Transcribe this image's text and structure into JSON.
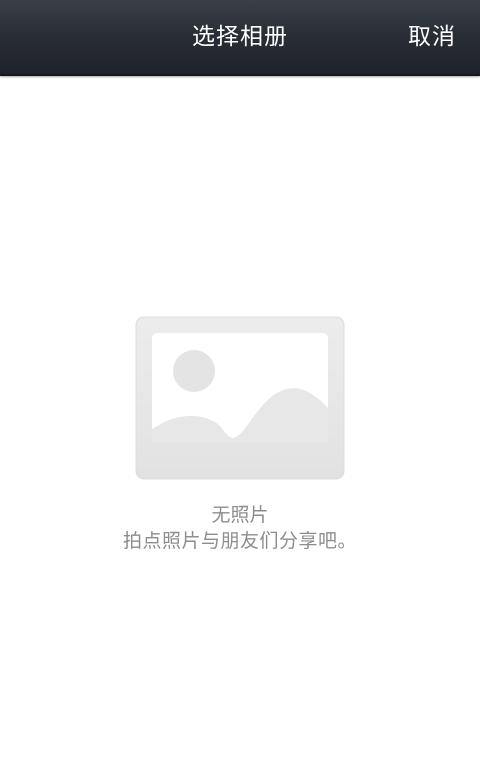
{
  "header": {
    "title": "选择相册",
    "cancel_label": "取消"
  },
  "empty_state": {
    "icon": "image-placeholder-icon",
    "title": "无照片",
    "subtitle": "拍点照片与朋友们分享吧。"
  },
  "colors": {
    "title_bar": "#2a2e36",
    "title_text": "#ffffff",
    "background": "#ffffff",
    "empty_text": "#8d8d8d",
    "placeholder_fill": "#e8e8e8"
  }
}
